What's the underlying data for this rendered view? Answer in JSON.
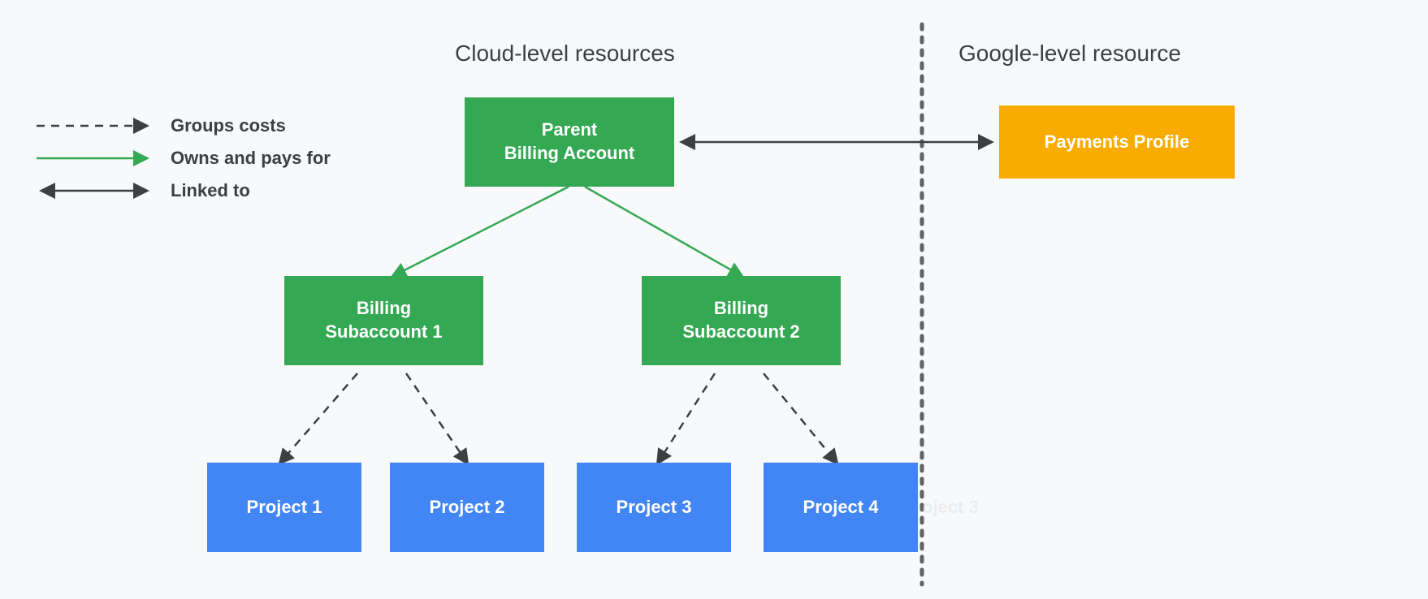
{
  "headings": {
    "cloud": "Cloud-level resources",
    "google": "Google-level resource"
  },
  "legend": {
    "groups_costs": "Groups costs",
    "owns_pays": "Owns and pays for",
    "linked_to": "Linked to"
  },
  "boxes": {
    "parent_billing": "Parent\nBilling Account",
    "payments_profile": "Payments Profile",
    "sub1": "Billing\nSubaccount 1",
    "sub2": "Billing\nSubaccount 2",
    "project1": "Project 1",
    "project2": "Project 2",
    "project3": "Project 3",
    "project4": "Project 4"
  },
  "ghost": "oject 3",
  "colors": {
    "green": "#34a853",
    "blue": "#4285f4",
    "yellow": "#f9ab00",
    "gray": "#3c4043"
  }
}
